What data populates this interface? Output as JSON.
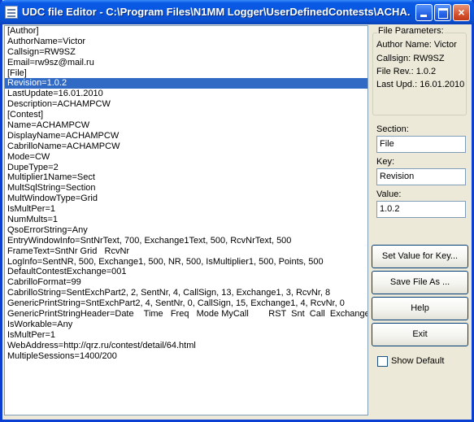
{
  "window": {
    "title": "UDC file Editor - C:\\Program Files\\N1MM Logger\\UserDefinedContests\\ACHA...",
    "close_glyph": "×"
  },
  "file_lines": [
    "[Author]",
    "AuthorName=Victor",
    "Callsign=RW9SZ",
    "Email=rw9sz@mail.ru",
    "[File]",
    "Revision=1.0.2",
    "LastUpdate=16.01.2010",
    "Description=ACHAMPCW",
    "[Contest]",
    "Name=ACHAMPCW",
    "DisplayName=ACHAMPCW",
    "CabrilloName=ACHAMPCW",
    "Mode=CW",
    "DupeType=2",
    "Multiplier1Name=Sect",
    "MultSqlString=Section",
    "MultWindowType=Grid",
    "IsMultPer=1",
    "NumMults=1",
    "QsoErrorString=Any",
    "EntryWindowInfo=SntNrText, 700, Exchange1Text, 500, RcvNrText, 500",
    "FrameText=SntNr Grid   RcvNr",
    "LogInfo=SentNR, 500, Exchange1, 500, NR, 500, IsMultiplier1, 500, Points, 500",
    "DefaultContestExchange=001",
    "CabrilloFormat=99",
    "CabrilloString=SentExchPart2, 2, SentNr, 4, CallSign, 13, Exchange1, 3, RcvNr, 8",
    "GenericPrintString=SntExchPart2, 4, SentNr, 0, CallSign, 15, Exchange1, 4, RcvNr, 0",
    "GenericPrintStringHeader=Date    Time   Freq   Mode MyCall        RST  Snt  Call  Exchange",
    "IsWorkable=Any",
    "IsMultPer=1",
    "WebAddress=http://qrz.ru/contest/detail/64.html",
    "MultipleSessions=1400/200"
  ],
  "selected_line": 5,
  "file_parameters": {
    "caption": "File Parameters:",
    "author": "Author Name: Victor",
    "callsign": "Callsign: RW9SZ",
    "file_rev": "File Rev.: 1.0.2",
    "last_upd": "Last Upd.: 16.01.2010"
  },
  "section": {
    "label": "Section:",
    "value": "File"
  },
  "key": {
    "label": "Key:",
    "value": "Revision"
  },
  "value": {
    "label": "Value:",
    "value": "1.0.2"
  },
  "buttons": {
    "set_value": "Set Value for Key...",
    "save_file": "Save File As ...",
    "help": "Help",
    "exit": "Exit"
  },
  "show_default": {
    "label": "Show Default",
    "checked": false
  },
  "colors": {
    "selection": "#316ac5",
    "titlebar": "#0855dd",
    "face": "#ece9d8"
  }
}
